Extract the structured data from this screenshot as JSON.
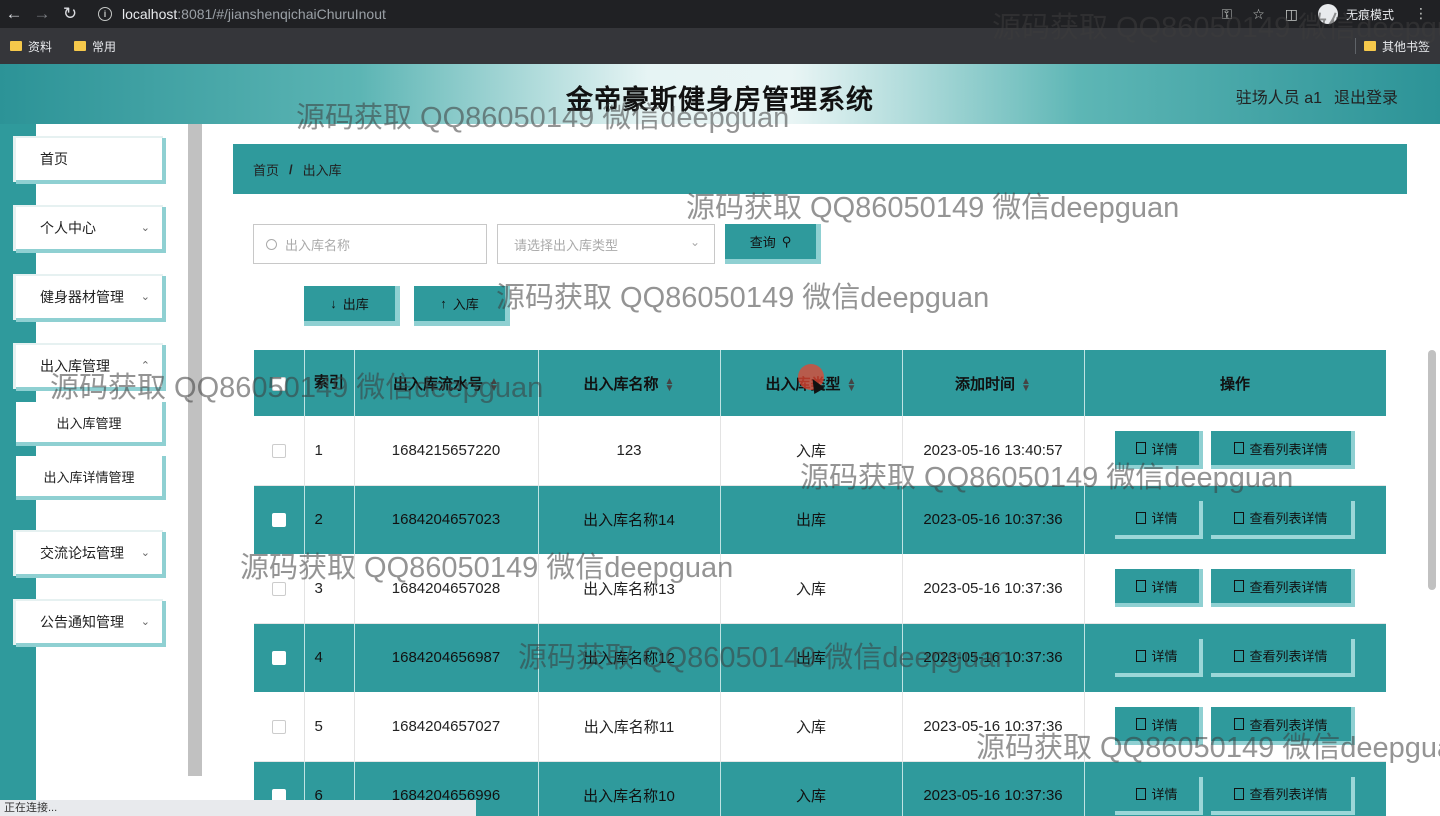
{
  "browser": {
    "url_host": "localhost",
    "url_rest": ":8081/#/jianshenqichaiChuruInout",
    "incognito_label": "无痕模式",
    "bookmarks": [
      "资料",
      "常用"
    ],
    "other_bookmarks": "其他书签",
    "status_text": "正在连接..."
  },
  "header": {
    "title": "金帝豪斯健身房管理系统",
    "user": "驻场人员 a1",
    "logout": "退出登录"
  },
  "sidebar": {
    "items": [
      {
        "label": "首页"
      },
      {
        "label": "个人中心"
      },
      {
        "label": "健身器材管理"
      },
      {
        "label": "出入库管理"
      },
      {
        "label": "交流论坛管理"
      },
      {
        "label": "公告通知管理"
      }
    ],
    "sub_items": [
      "出入库管理",
      "出入库详情管理"
    ]
  },
  "breadcrumb": {
    "home": "首页",
    "current": "出入库"
  },
  "search": {
    "name_placeholder": "出入库名称",
    "type_placeholder": "请选择出入库类型",
    "query_label": "查询",
    "out_label": "出库",
    "in_label": "入库"
  },
  "table": {
    "headers": [
      "索引",
      "出入库流水号",
      "出入库名称",
      "出入库类型",
      "添加时间",
      "操作"
    ],
    "detail_label": "详情",
    "list_detail_label": "查看列表详情",
    "rows": [
      {
        "index": "1",
        "serial": "1684215657220",
        "name": "123",
        "type": "入库",
        "time": "2023-05-16 13:40:57"
      },
      {
        "index": "2",
        "serial": "1684204657023",
        "name": "出入库名称14",
        "type": "出库",
        "time": "2023-05-16 10:37:36"
      },
      {
        "index": "3",
        "serial": "1684204657028",
        "name": "出入库名称13",
        "type": "入库",
        "time": "2023-05-16 10:37:36"
      },
      {
        "index": "4",
        "serial": "1684204656987",
        "name": "出入库名称12",
        "type": "出库",
        "time": "2023-05-16 10:37:36"
      },
      {
        "index": "5",
        "serial": "1684204657027",
        "name": "出入库名称11",
        "type": "入库",
        "time": "2023-05-16 10:37:36"
      },
      {
        "index": "6",
        "serial": "1684204656996",
        "name": "出入库名称10",
        "type": "入库",
        "time": "2023-05-16 10:37:36"
      }
    ]
  },
  "watermark": "源码获取 QQ86050149 微信deepguan",
  "colors": {
    "accent": "#2f9a9c",
    "accent_light": "#8fd0d2"
  }
}
